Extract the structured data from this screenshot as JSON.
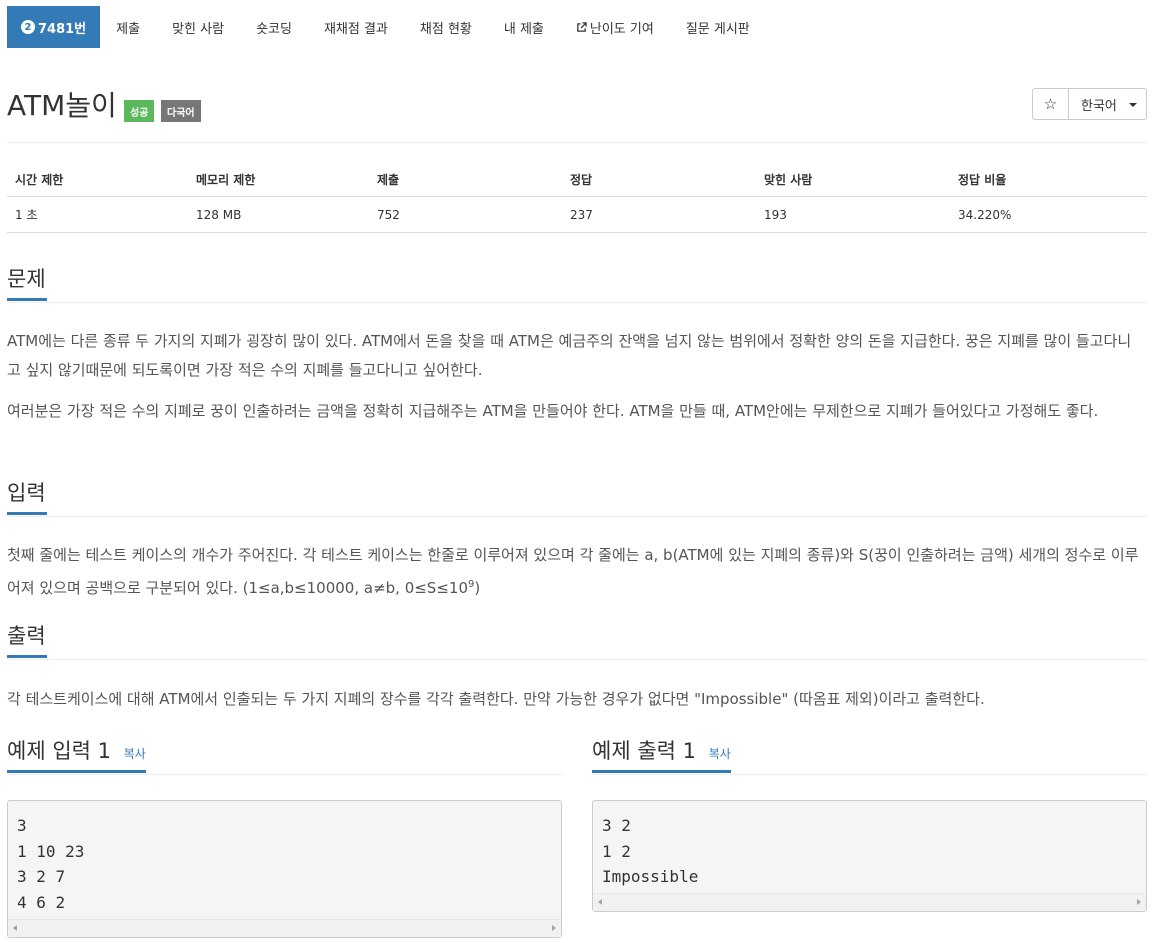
{
  "nav": {
    "problem_id": "7481번",
    "items": [
      "제출",
      "맞힌 사람",
      "숏코딩",
      "재채점 결과",
      "채점 현황",
      "내 제출",
      "난이도 기여",
      "질문 게시판"
    ]
  },
  "problem": {
    "title": "ATM놀이",
    "label_success": "성공",
    "label_multilang": "다국어",
    "star": "☆",
    "language": "한국어"
  },
  "info_table": {
    "headers": [
      "시간 제한",
      "메모리 제한",
      "제출",
      "정답",
      "맞힌 사람",
      "정답 비율"
    ],
    "values": [
      "1 초",
      "128 MB",
      "752",
      "237",
      "193",
      "34.220%"
    ]
  },
  "sections": {
    "description_title": "문제",
    "description_p1": "ATM에는 다른 종류 두 가지의 지폐가 굉장히 많이 있다. ATM에서 돈을 찾을 때 ATM은 예금주의 잔액을 넘지 않는 범위에서 정확한 양의 돈을 지급한다. 꿍은 지폐를 많이 들고다니고 싶지 않기때문에 되도록이면 가장 적은 수의 지폐를 들고다니고 싶어한다.",
    "description_p2": "여러분은 가장 적은 수의 지폐로 꿍이 인출하려는 금액을 정확히 지급해주는 ATM을 만들어야 한다. ATM을 만들 때, ATM안에는 무제한으로 지폐가 들어있다고 가정해도 좋다.",
    "input_title": "입력",
    "input_text": "첫째 줄에는 테스트 케이스의 개수가 주어진다. 각 테스트 케이스는 한줄로 이루어져 있으며 각 줄에는 a, b(ATM에 있는 지폐의 종류)와 S(꿍이 인출하려는 금액) 세개의 정수로 이루어져 있으며 공백으로 구분되어 있다. (1≤a,b≤10000, a≠b, 0≤S≤10",
    "input_sup": "9",
    "input_tail": ")",
    "output_title": "출력",
    "output_text": "각 테스트케이스에 대해 ATM에서 인출되는 두 가지 지폐의 장수를 각각 출력한다. 만약 가능한 경우가 없다면 \"Impossible\" (따옴표 제외)이라고 출력한다."
  },
  "samples": {
    "input_title": "예제 입력 1",
    "output_title": "예제 출력 1",
    "copy": "복사",
    "input_text": "3\n1 10 23\n3 2 7\n4 6 2",
    "output_text": "3 2\n1 2\nImpossible"
  }
}
